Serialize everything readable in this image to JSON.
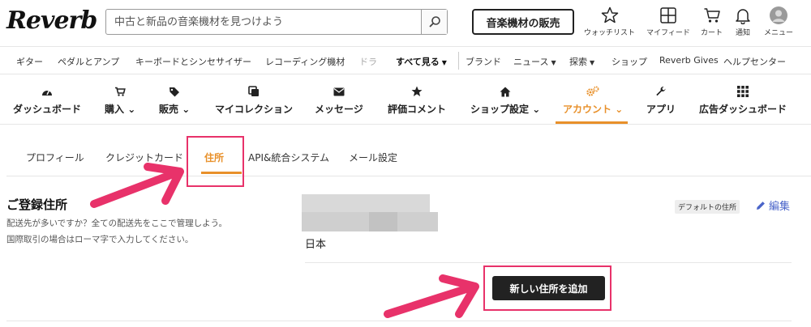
{
  "header": {
    "logo": "Reverb",
    "search_placeholder": "中古と新品の音楽機材を見つけよう",
    "sell_label": "音楽機材の販売",
    "icons": [
      {
        "name": "watchlist",
        "label": "ウォッチリスト"
      },
      {
        "name": "feed",
        "label": "マイフィード"
      },
      {
        "name": "cart",
        "label": "カート"
      },
      {
        "name": "notifications",
        "label": "通知"
      },
      {
        "name": "menu",
        "label": "メニュー"
      }
    ]
  },
  "category_nav": {
    "items": [
      "ギター",
      "ペダルとアンプ",
      "キーボードとシンセサイザー",
      "レコーディング機材",
      "ドラ"
    ],
    "see_all": "すべて見る",
    "right_items": [
      "ブランド",
      "ニュース",
      "探索",
      "ショップ",
      "Reverb Gives",
      "ヘルプセンター"
    ]
  },
  "dashboard_nav": {
    "items": [
      {
        "label": "ダッシュボード",
        "icon": "gauge-icon"
      },
      {
        "label": "購入",
        "icon": "cart-icon"
      },
      {
        "label": "販売",
        "icon": "tag-icon"
      },
      {
        "label": "マイコレクション",
        "icon": "collection-icon"
      },
      {
        "label": "メッセージ",
        "icon": "envelope-icon"
      },
      {
        "label": "評価コメント",
        "icon": "star-icon"
      },
      {
        "label": "ショップ設定",
        "icon": "home-icon"
      },
      {
        "label": "アカウント",
        "icon": "gears-icon"
      },
      {
        "label": "アプリ",
        "icon": "wrench-icon"
      },
      {
        "label": "広告ダッシュボード",
        "icon": "grid-icon"
      }
    ],
    "active": "アカウント"
  },
  "account_tabs": {
    "items": [
      "プロフィール",
      "クレジットカード",
      "住所",
      "API&統合システム",
      "メール設定"
    ],
    "active": "住所"
  },
  "addresses": {
    "title": "ご登録住所",
    "description_1": "配送先が多いですか？全ての配送先をここで管理しよう。",
    "description_2": "国際取引の場合はローマ字で入力してください。",
    "country": "日本",
    "default_badge": "デフォルトの住所",
    "edit_label": "編集",
    "add_button": "新しい住所を追加"
  },
  "colors": {
    "accent": "#e8902a",
    "highlight": "#e8326a",
    "link": "#4a64c9",
    "button_dark": "#222222"
  }
}
